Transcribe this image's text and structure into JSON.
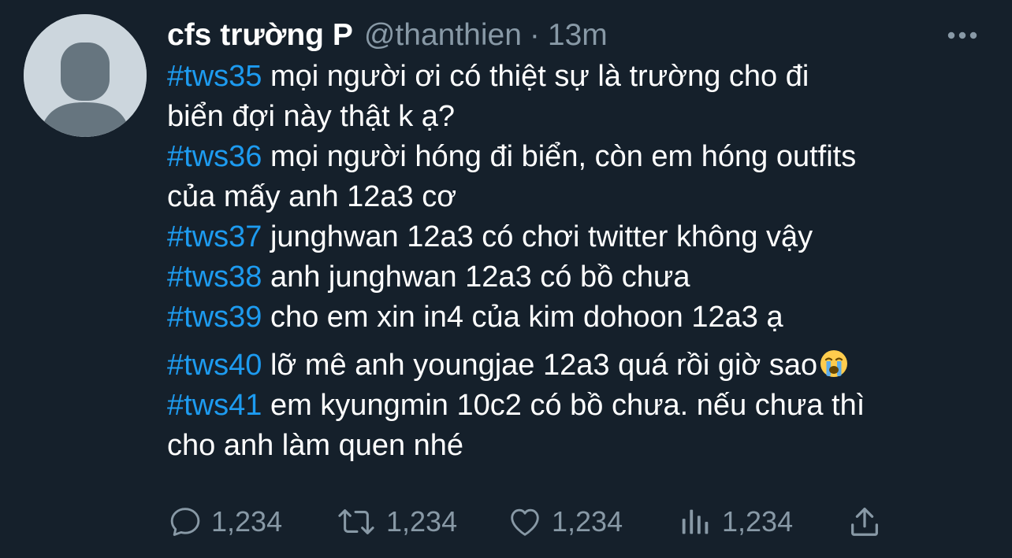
{
  "tweet": {
    "author": {
      "display_name": "cfs trường P",
      "handle": "@thanthien",
      "separator": "·",
      "time": "13m"
    },
    "lines": [
      {
        "hashtag": "#tws35",
        "text": " mọi người ơi có thiệt sự là trường cho đi"
      },
      {
        "hashtag": "",
        "text": "biển đợi này thật k ạ?"
      },
      {
        "hashtag": "#tws36",
        "text": " mọi người hóng đi biển, còn em hóng outfits"
      },
      {
        "hashtag": "",
        "text": "của mấy anh 12a3 cơ"
      },
      {
        "hashtag": "#tws37",
        "text": " junghwan 12a3 có chơi twitter không vậy"
      },
      {
        "hashtag": "#tws38",
        "text": " anh junghwan 12a3 có bồ chưa"
      },
      {
        "hashtag": "#tws39",
        "text": " cho em xin in4 của kim dohoon 12a3 ạ"
      },
      {
        "hashtag": "#tws40",
        "text": " lỡ mê anh youngjae 12a3 quá rồi giờ sao"
      },
      {
        "hashtag": "#tws41",
        "text": " em kyungmin 10c2 có bồ chưa. nếu chưa thì"
      },
      {
        "hashtag": "",
        "text": "cho anh làm quen nhé"
      }
    ],
    "emoji": "loudly-crying-face-emoji"
  },
  "actions": {
    "reply_count": "1,234",
    "retweet_count": "1,234",
    "like_count": "1,234",
    "views_count": "1,234"
  },
  "icons": {
    "reply": "reply-icon",
    "retweet": "retweet-icon",
    "like": "heart-icon",
    "views": "analytics-icon",
    "share": "share-icon",
    "more": "more-icon"
  },
  "colors": {
    "background": "#15202b",
    "hashtag": "#1d9bf0",
    "secondary_text": "#8899a6",
    "avatar_bg": "#ccd6dd",
    "avatar_figure": "#66757f"
  }
}
